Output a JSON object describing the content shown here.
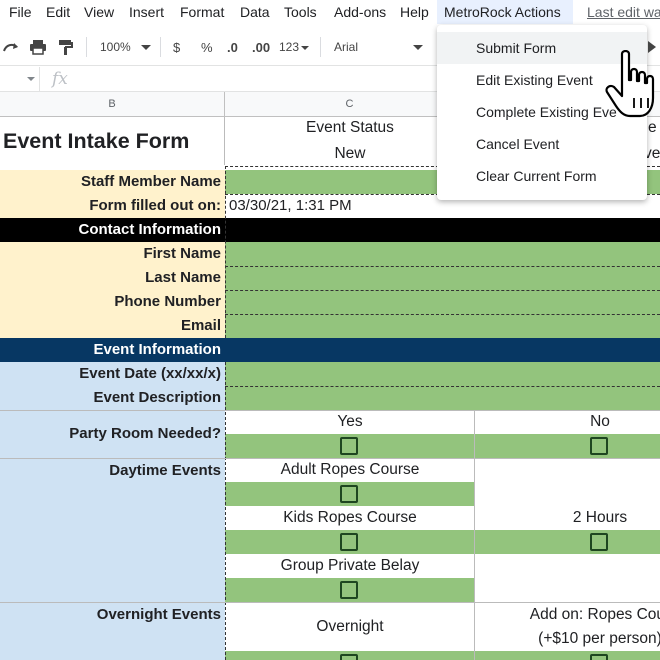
{
  "menu": {
    "file": "File",
    "edit": "Edit",
    "view": "View",
    "insert": "Insert",
    "format": "Format",
    "data": "Data",
    "tools": "Tools",
    "addons": "Add-ons",
    "help": "Help",
    "metrorock": "MetroRock Actions",
    "last_edit": "Last edit wa"
  },
  "toolbar": {
    "zoom": "100%",
    "currency": "$",
    "percent": "%",
    "dec_decrease": ".0",
    "dec_increase": ".00",
    "more_formats": "123",
    "font": "Arial"
  },
  "formula_bar": {
    "fx": "fx"
  },
  "columns": {
    "b": "B",
    "c": "C"
  },
  "form": {
    "title": "Event Intake Form",
    "event_status_label": "Event Status",
    "event_status_value": "New",
    "d_header_partial": "e",
    "d_value_partial": "ve",
    "staff_member_name": "Staff Member Name",
    "form_filled_out_on": "Form filled out on:",
    "form_filled_value": "03/30/21, 1:31 PM",
    "contact_information": "Contact Information",
    "first_name": "First Name",
    "last_name": "Last Name",
    "phone_number": "Phone Number",
    "email": "Email",
    "event_information": "Event Information",
    "event_date": "Event Date (xx/xx/x)",
    "event_description": "Event Description",
    "party_room_needed": "Party Room Needed?",
    "yes": "Yes",
    "no": "No",
    "daytime_events": "Daytime Events",
    "adult_ropes_course": "Adult Ropes Course",
    "kids_ropes_course": "Kids Ropes Course",
    "two_hours": "2 Hours",
    "group_private_belay": "Group Private Belay",
    "overnight_events": "Overnight Events",
    "overnight": "Overnight",
    "addon_ropes_line1": "Add on: Ropes Cour",
    "addon_ropes_line2": "(+$10 per person)"
  },
  "dropdown": {
    "items": [
      "Submit Form",
      "Edit Existing Event",
      "Complete Existing Eve",
      "Cancel Event",
      "Clear Current Form"
    ]
  }
}
